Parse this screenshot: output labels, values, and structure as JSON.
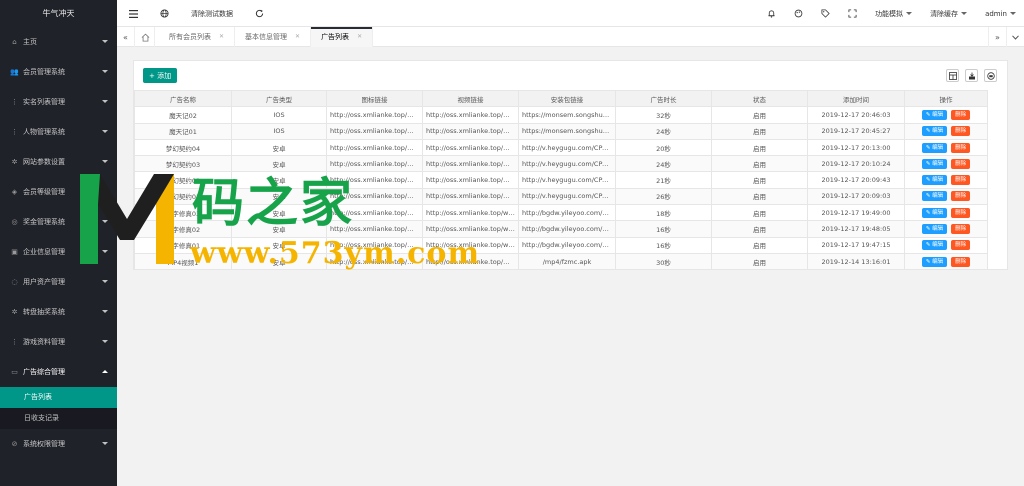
{
  "sidebar": {
    "brand": "牛气冲天",
    "items": [
      {
        "label": "主页",
        "icon": "home-icon"
      },
      {
        "label": "会员管理系统",
        "icon": "users-icon"
      },
      {
        "label": "实名列表管理",
        "icon": "dots-icon"
      },
      {
        "label": "人物管理系统",
        "icon": "dots-icon"
      },
      {
        "label": "网站参数设置",
        "icon": "gear-icon"
      },
      {
        "label": "会员等级管理",
        "icon": "diamond-icon"
      },
      {
        "label": "奖金管理系统",
        "icon": "circle-icon"
      },
      {
        "label": "企业信息管理",
        "icon": "building-icon"
      },
      {
        "label": "用户资产管理",
        "icon": "wallet-icon"
      },
      {
        "label": "转盘抽奖系统",
        "icon": "gear-icon"
      },
      {
        "label": "游戏资料管理",
        "icon": "dots-icon"
      },
      {
        "label": "广告综合管理",
        "icon": "chat-icon"
      }
    ],
    "sub_items": [
      {
        "label": "广告列表"
      },
      {
        "label": "日收支记录"
      }
    ],
    "last_item": {
      "label": "系统权限管理",
      "icon": "shield-icon"
    }
  },
  "header": {
    "clear_test_data": "清除测试数据",
    "function_mode": "功能模拟",
    "clear_cache": "清除缓存",
    "user": "admin"
  },
  "tabs": [
    {
      "label": "所有会员列表"
    },
    {
      "label": "基本信息管理"
    },
    {
      "label": "广告列表"
    }
  ],
  "toolbar": {
    "add_label": "+ 添加"
  },
  "table": {
    "headers": [
      "广告名称",
      "广告类型",
      "图标链接",
      "视频链接",
      "安装包链接",
      "广告时长",
      "状态",
      "添加时间",
      "操作"
    ],
    "edit_label": "✎ 编辑",
    "delete_label": "删除",
    "rows": [
      [
        "魔天记02",
        "IOS",
        "http://oss.xmlianke.top/m...",
        "http://oss.xmlianke.top/m...",
        "https://monsem.songshug...",
        "32秒",
        "启用",
        "2019-12-17 20:46:03"
      ],
      [
        "魔天记01",
        "IOS",
        "http://oss.xmlianke.top/m...",
        "http://oss.xmlianke.top/m...",
        "https://monsem.songshug...",
        "24秒",
        "启用",
        "2019-12-17 20:45:27"
      ],
      [
        "梦幻契约04",
        "安卓",
        "http://oss.xmlianke.top/m...",
        "http://oss.xmlianke.top/m...",
        "http://v.heygugu.com/CPA...",
        "20秒",
        "启用",
        "2019-12-17 20:13:00"
      ],
      [
        "梦幻契约03",
        "安卓",
        "http://oss.xmlianke.top/m...",
        "http://oss.xmlianke.top/m...",
        "http://v.heygugu.com/CPA...",
        "24秒",
        "启用",
        "2019-12-17 20:10:24"
      ],
      [
        "梦幻契约02",
        "安卓",
        "http://oss.xmlianke.top/m...",
        "http://oss.xmlianke.top/m...",
        "http://v.heygugu.com/CPA...",
        "21秒",
        "启用",
        "2019-12-17 20:09:43"
      ],
      [
        "梦幻契约01",
        "安卓",
        "http://oss.xmlianke.top/m...",
        "http://oss.xmlianke.top/m...",
        "http://v.heygugu.com/CPA...",
        "26秒",
        "启用",
        "2019-12-17 20:09:03"
      ],
      [
        "文字修真03",
        "安卓",
        "http://oss.xmlianke.top/m...",
        "http://oss.xmlianke.top/we...",
        "http://bgdw.yileyoo.com/Yi...",
        "18秒",
        "启用",
        "2019-12-17 19:49:00"
      ],
      [
        "文字修真02",
        "安卓",
        "http://oss.xmlianke.top/m...",
        "http://oss.xmlianke.top/we...",
        "http://bgdw.yileyoo.com/Yi...",
        "16秒",
        "启用",
        "2019-12-17 19:48:05"
      ],
      [
        "文字修真01",
        "安卓",
        "http://oss.xmlianke.top/m...",
        "http://oss.xmlianke.top/we...",
        "http://bgdw.yileyoo.com/Yi...",
        "16秒",
        "启用",
        "2019-12-17 19:47:15"
      ],
      [
        "MP4视频1",
        "安卓",
        "http://oss.xmlianke.top/m...",
        "http://oss.xmlianke.top/%...",
        "/mp4/fzmc.apk",
        "30秒",
        "启用",
        "2019-12-14 13:16:01"
      ]
    ]
  },
  "watermark": {
    "text": "码之家",
    "url": "www.573ym.com"
  }
}
